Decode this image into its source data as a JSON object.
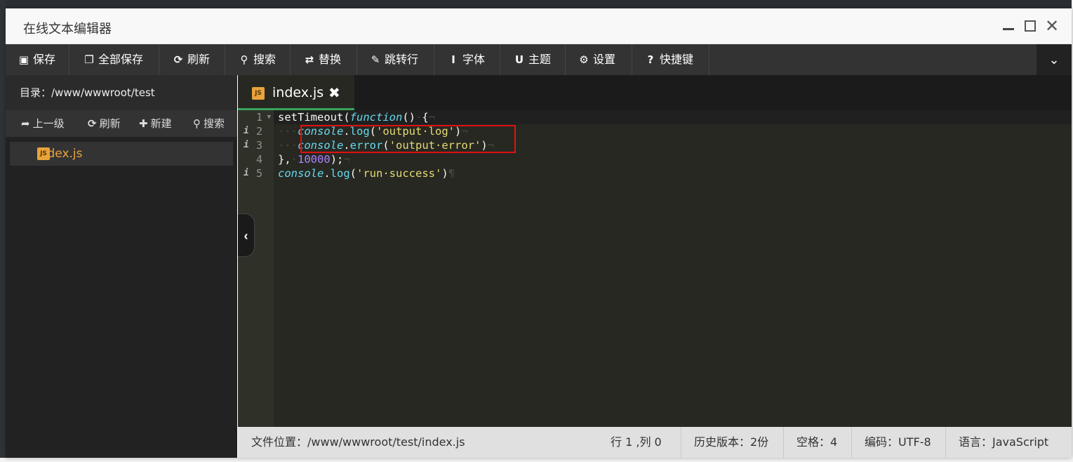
{
  "window": {
    "title": "在线文本编辑器",
    "close_symbol": "✕"
  },
  "toolbar": {
    "items": [
      {
        "icon": "save-icon",
        "glyph": "💾",
        "label": "保存"
      },
      {
        "icon": "copy-icon",
        "glyph": "❐",
        "label": "全部保存"
      },
      {
        "icon": "refresh-icon",
        "glyph": "⟳",
        "label": "刷新"
      },
      {
        "icon": "search-icon",
        "glyph": "⚲",
        "label": "搜索"
      },
      {
        "icon": "retweet-icon",
        "glyph": "⇄",
        "label": "替换"
      },
      {
        "icon": "pin-icon",
        "glyph": "✎",
        "label": "跳转行"
      },
      {
        "icon": "text-icon",
        "glyph": "I",
        "label": "字体"
      },
      {
        "icon": "magnet-icon",
        "glyph": "U",
        "label": "主题"
      },
      {
        "icon": "gear-icon",
        "glyph": "⚙",
        "label": "设置"
      },
      {
        "icon": "question-icon",
        "glyph": "?",
        "label": "快捷键"
      }
    ],
    "more_glyph": "⌄"
  },
  "sidebar": {
    "directory_label": "目录：/www/wwwroot/test",
    "actions": [
      {
        "icon": "share-icon",
        "glyph": "➦",
        "label": "上一级"
      },
      {
        "icon": "refresh-icon",
        "glyph": "⟳",
        "label": "刷新"
      },
      {
        "icon": "plus-icon",
        "glyph": "✚",
        "label": "新建"
      },
      {
        "icon": "search-icon",
        "glyph": "⚲",
        "label": "搜索"
      }
    ],
    "files": [
      {
        "name": "index.js",
        "badge": "JS"
      }
    ]
  },
  "editor": {
    "tab": {
      "name": "index.js",
      "badge": "JS",
      "close": "✖"
    },
    "collapse_glyph": "‹",
    "line_numbers": [
      "1",
      "2",
      "3",
      "4",
      "5"
    ],
    "info_marker": "i",
    "code": {
      "l1": [
        "setTimeout(",
        "function",
        "()",
        "·",
        "{",
        "¬"
      ],
      "l2": [
        "···",
        "console",
        ".",
        "log",
        "(",
        "'output·log'",
        ")",
        "¬"
      ],
      "l3": [
        "···",
        "console",
        ".",
        "error",
        "(",
        "'output·error'",
        ")",
        "¬"
      ],
      "l4": [
        "},",
        "·",
        "10000",
        ");",
        "¬"
      ],
      "l5": [
        "console",
        ".",
        "log",
        "(",
        "'run·success'",
        ")",
        "¶"
      ]
    }
  },
  "status": {
    "file_location": "文件位置：/www/wwwroot/test/index.js",
    "cursor": "行 1 ,列 0",
    "history": "历史版本：2份",
    "indent": "空格：4",
    "encoding": "编码：UTF-8",
    "language": "语言：JavaScript"
  },
  "colors": {
    "highlight_box": "#e01010",
    "active_tab_border": "#3aa35a",
    "file_name": "#e8a33d"
  }
}
